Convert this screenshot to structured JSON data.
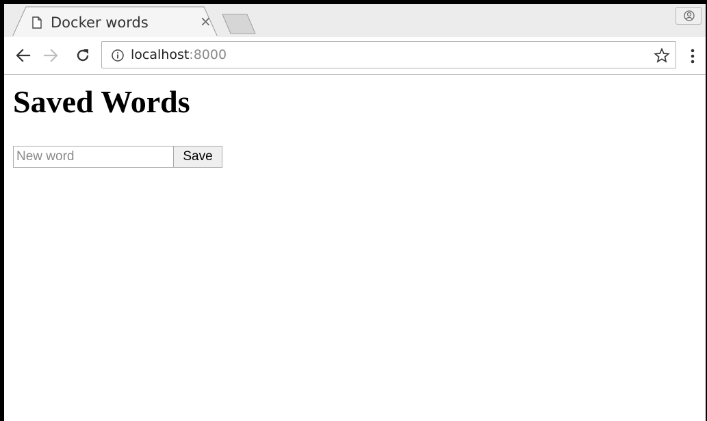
{
  "browser": {
    "tab": {
      "title": "Docker words",
      "close_glyph": "×",
      "icon": "page-icon"
    },
    "new_tab_icon": "new-tab-icon",
    "profile_icon": "profile-icon",
    "toolbar": {
      "back_icon": "back-arrow-icon",
      "forward_icon": "forward-arrow-icon",
      "reload_icon": "reload-icon",
      "menu_icon": "more-vert-icon"
    },
    "omnibox": {
      "info_icon": "info-icon",
      "host": "localhost",
      "port": ":8000",
      "bookmark_icon": "star-icon"
    }
  },
  "page": {
    "title": "Saved Words",
    "form": {
      "input_value": "",
      "input_placeholder": "New word",
      "save_label": "Save"
    }
  },
  "colors": {
    "tabstrip_bg": "#ececec",
    "toolbar_bg": "#ffffff",
    "border": "#a8a8a8",
    "url_port": "#8a8a8a"
  }
}
